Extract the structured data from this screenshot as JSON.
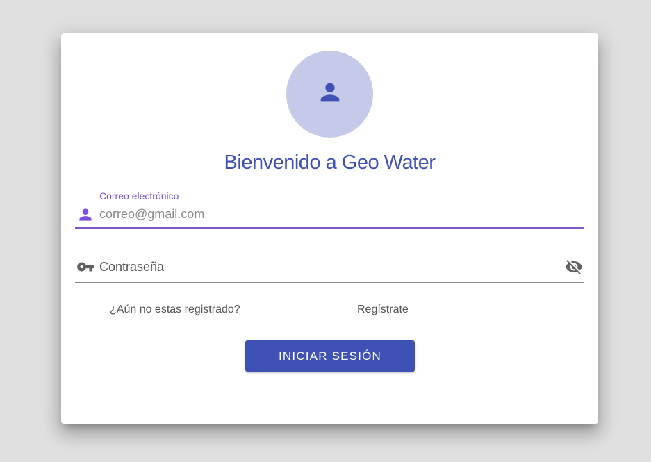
{
  "colors": {
    "primary": "#3f51b5",
    "avatar_bg": "#c5cae9",
    "focus_accent": "#7e57c2",
    "background": "#e0e0e0",
    "card": "#ffffff"
  },
  "avatar": {
    "icon": "person-icon"
  },
  "title": "Bienvenido a Geo Water",
  "email_field": {
    "label": "Correo electrónico",
    "placeholder": "correo@gmail.com",
    "value": "",
    "icon": "person-icon",
    "focused": true
  },
  "password_field": {
    "placeholder": "Contraseña",
    "value": "",
    "icon": "key-icon",
    "toggle_icon": "eye-off-icon"
  },
  "register": {
    "question": "¿Aún no estas registrado?",
    "link": "Regístrate"
  },
  "login_button": {
    "label": "INICIAR SESIÓN"
  }
}
